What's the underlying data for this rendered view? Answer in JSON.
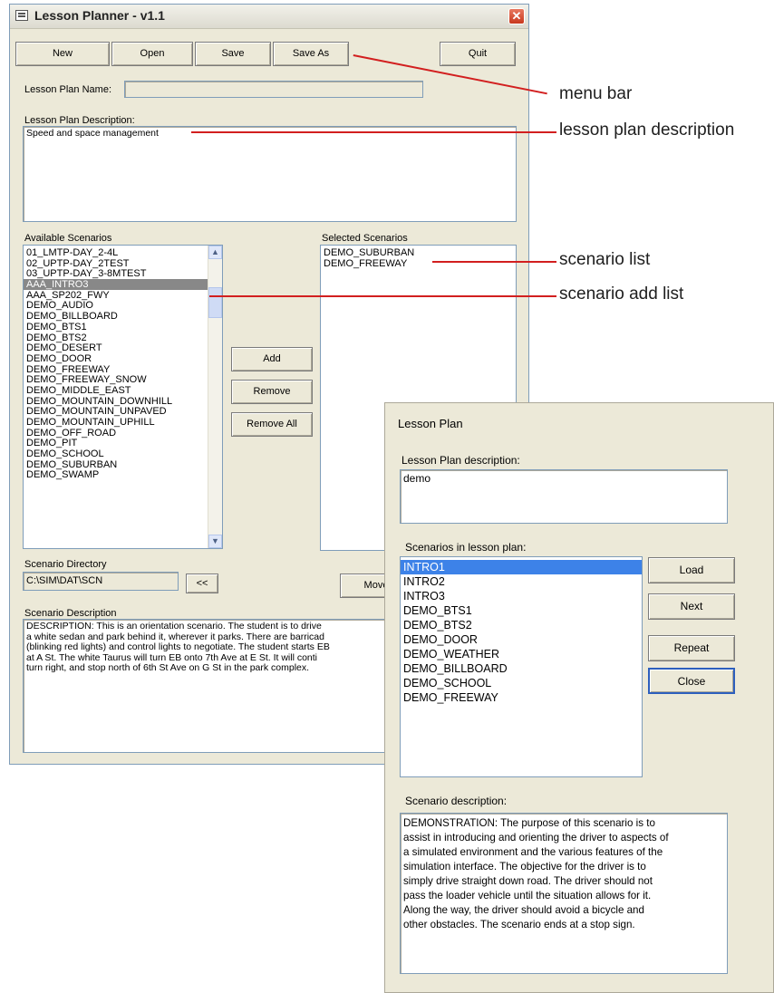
{
  "window": {
    "title": "Lesson Planner - v1.1",
    "close_glyph": "✕"
  },
  "menu": {
    "new": "New",
    "open": "Open",
    "save": "Save",
    "save_as": "Save As",
    "quit": "Quit"
  },
  "fields": {
    "name_label": "Lesson Plan Name:",
    "name_value": "",
    "desc_label": "Lesson Plan Description:",
    "desc_value": "Speed and space management"
  },
  "available": {
    "label": "Available Scenarios",
    "items": [
      "01_LMTP-DAY_2-4L",
      "02_UPTP-DAY_2TEST",
      "03_UPTP-DAY_3-8MTEST",
      "AAA_INTRO3",
      "AAA_SP202_FWY",
      "DEMO_AUDIO",
      "DEMO_BILLBOARD",
      "DEMO_BTS1",
      "DEMO_BTS2",
      "DEMO_DESERT",
      "DEMO_DOOR",
      "DEMO_FREEWAY",
      "DEMO_FREEWAY_SNOW",
      "DEMO_MIDDLE_EAST",
      "DEMO_MOUNTAIN_DOWNHILL",
      "DEMO_MOUNTAIN_UNPAVED",
      "DEMO_MOUNTAIN_UPHILL",
      "DEMO_OFF_ROAD",
      "DEMO_PIT",
      "DEMO_SCHOOL",
      "DEMO_SUBURBAN",
      "DEMO_SWAMP"
    ],
    "selected": "AAA_INTRO3"
  },
  "selected_scenarios": {
    "label": "Selected Scenarios",
    "items": [
      "DEMO_SUBURBAN",
      "DEMO_FREEWAY"
    ]
  },
  "list_buttons": {
    "add": "Add",
    "remove": "Remove",
    "remove_all": "Remove All"
  },
  "directory": {
    "label": "Scenario Directory",
    "value": "C:\\SIM\\DAT\\SCN",
    "browse": "<<",
    "move": "Move"
  },
  "scenario_desc": {
    "label": "Scenario Description",
    "lines": [
      "DESCRIPTION: This is an orientation scenario.  The student is to drive",
      "a white sedan and park behind it, wherever it parks.  There are barricad",
      "(blinking red lights) and control lights to negotiate. The student starts EB",
      "at A St.  The white Taurus will turn EB onto 7th Ave at E St.  It will conti",
      "turn right, and stop north of 6th St Ave on G St in the park complex."
    ]
  },
  "callouts": {
    "menu_bar": "menu bar",
    "lesson_desc": "lesson plan description",
    "scenario_list": "scenario list",
    "scenario_add": "scenario add list"
  },
  "popup": {
    "title": "Lesson Plan",
    "desc_label": "Lesson Plan description:",
    "desc_value": "demo",
    "list_label": "Scenarios in lesson plan:",
    "items": [
      "INTRO1",
      "INTRO2",
      "INTRO3",
      "DEMO_BTS1",
      "DEMO_BTS2",
      "DEMO_DOOR",
      "DEMO_WEATHER",
      "DEMO_BILLBOARD",
      "DEMO_SCHOOL",
      "DEMO_FREEWAY"
    ],
    "selected": "INTRO1",
    "buttons": {
      "load": "Load",
      "next": "Next",
      "repeat": "Repeat",
      "close": "Close"
    },
    "scen_desc_label": "Scenario description:",
    "scen_desc_lines": [
      "DEMONSTRATION:  The purpose of this scenario is to",
      "assist in introducing and orienting the driver to aspects of",
      "a simulated environment and the various features of the",
      "simulation interface.  The objective for the driver is to",
      "simply drive straight down road.  The driver should not",
      "pass the loader vehicle until the situation allows for it.",
      "Along the way, the driver should avoid a bicycle and",
      "other obstacles.  The scenario ends at a stop sign."
    ]
  },
  "colors": {
    "callout_line": "#d21f1f",
    "list_highlight": "#3d82e8"
  }
}
